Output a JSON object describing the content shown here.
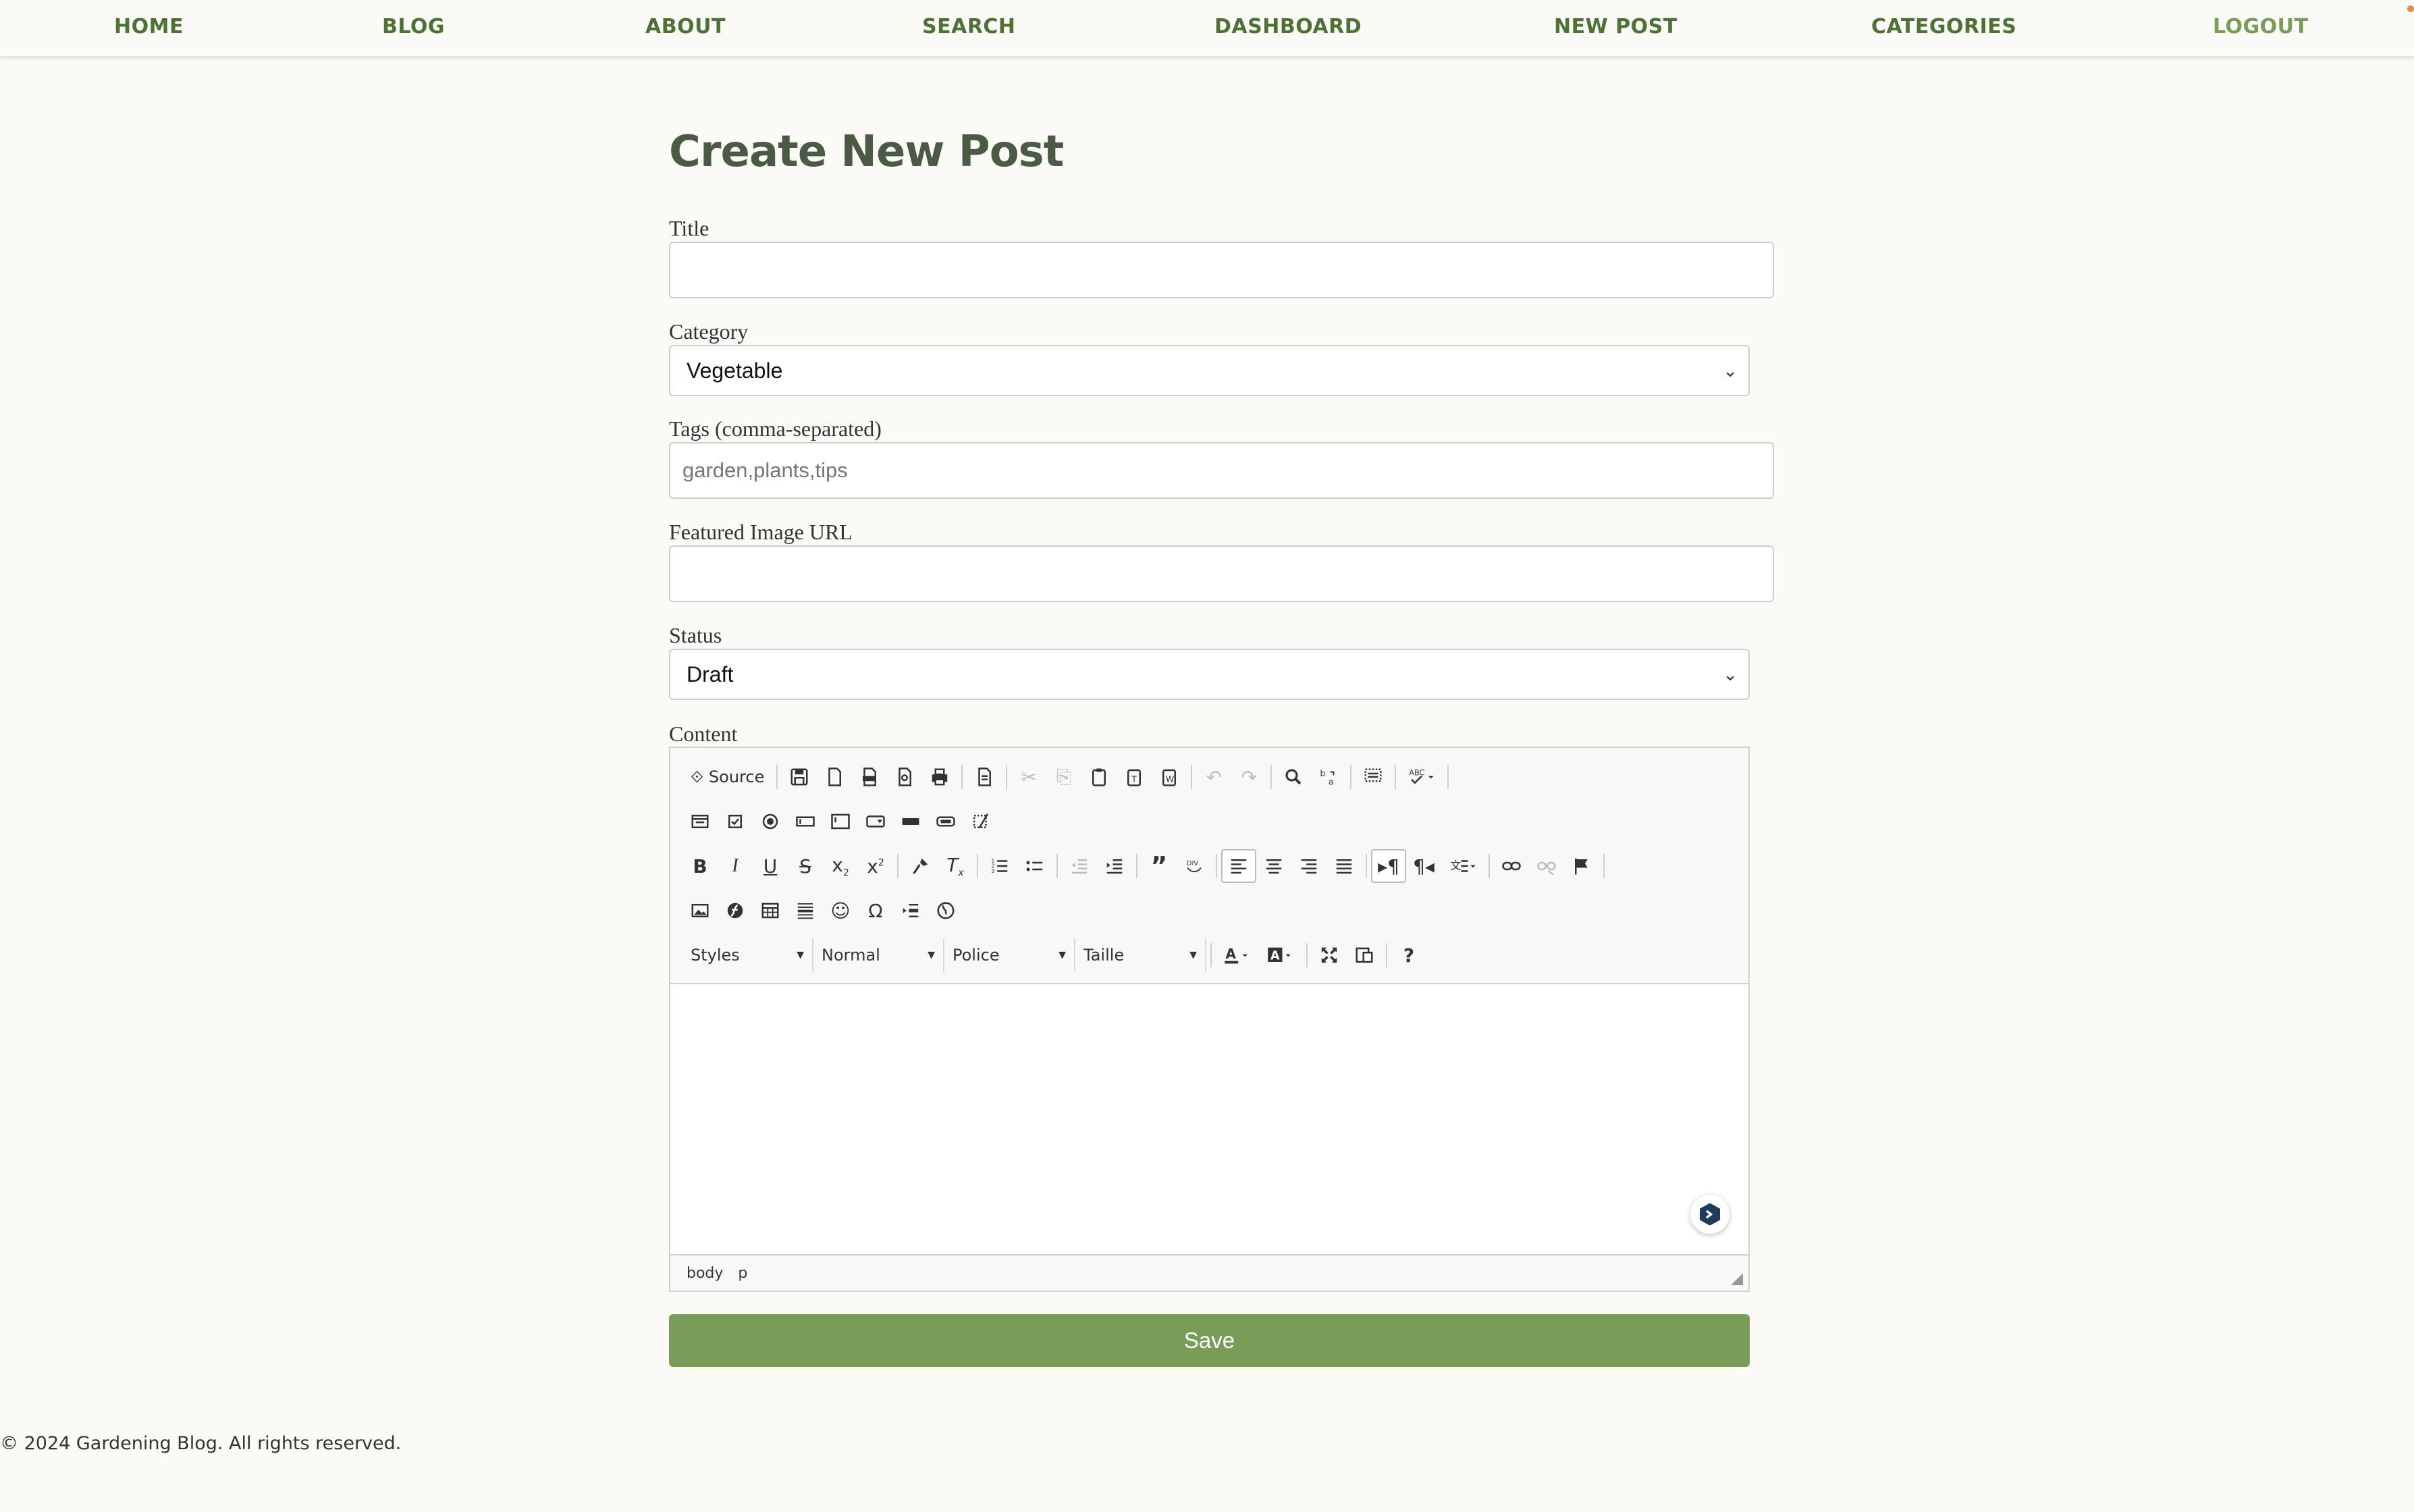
{
  "nav": {
    "items": [
      {
        "label": "HOME"
      },
      {
        "label": "BLOG"
      },
      {
        "label": "ABOUT"
      },
      {
        "label": "SEARCH"
      },
      {
        "label": "DASHBOARD"
      },
      {
        "label": "NEW POST"
      },
      {
        "label": "CATEGORIES"
      },
      {
        "label": "LOGOUT"
      }
    ]
  },
  "form": {
    "heading": "Create New Post",
    "title_label": "Title",
    "title_value": "",
    "category_label": "Category",
    "category_selected": "Vegetable",
    "tags_label": "Tags (comma-separated)",
    "tags_placeholder": "garden,plants,tips",
    "image_label": "Featured Image URL",
    "image_value": "",
    "status_label": "Status",
    "status_selected": "Draft",
    "content_label": "Content",
    "save_label": "Save"
  },
  "editor": {
    "source_label": "Source",
    "combos": {
      "styles": "Styles",
      "format": "Normal",
      "font": "Police",
      "size": "Taille"
    },
    "statusbar": [
      "body",
      "p"
    ]
  },
  "footer": {
    "text": "© 2024 Gardening Blog. All rights reserved."
  },
  "colors": {
    "accent": "#7a9c59",
    "nav_text": "#4e7135",
    "heading": "#4b5a44",
    "background": "#fbfaf7"
  }
}
